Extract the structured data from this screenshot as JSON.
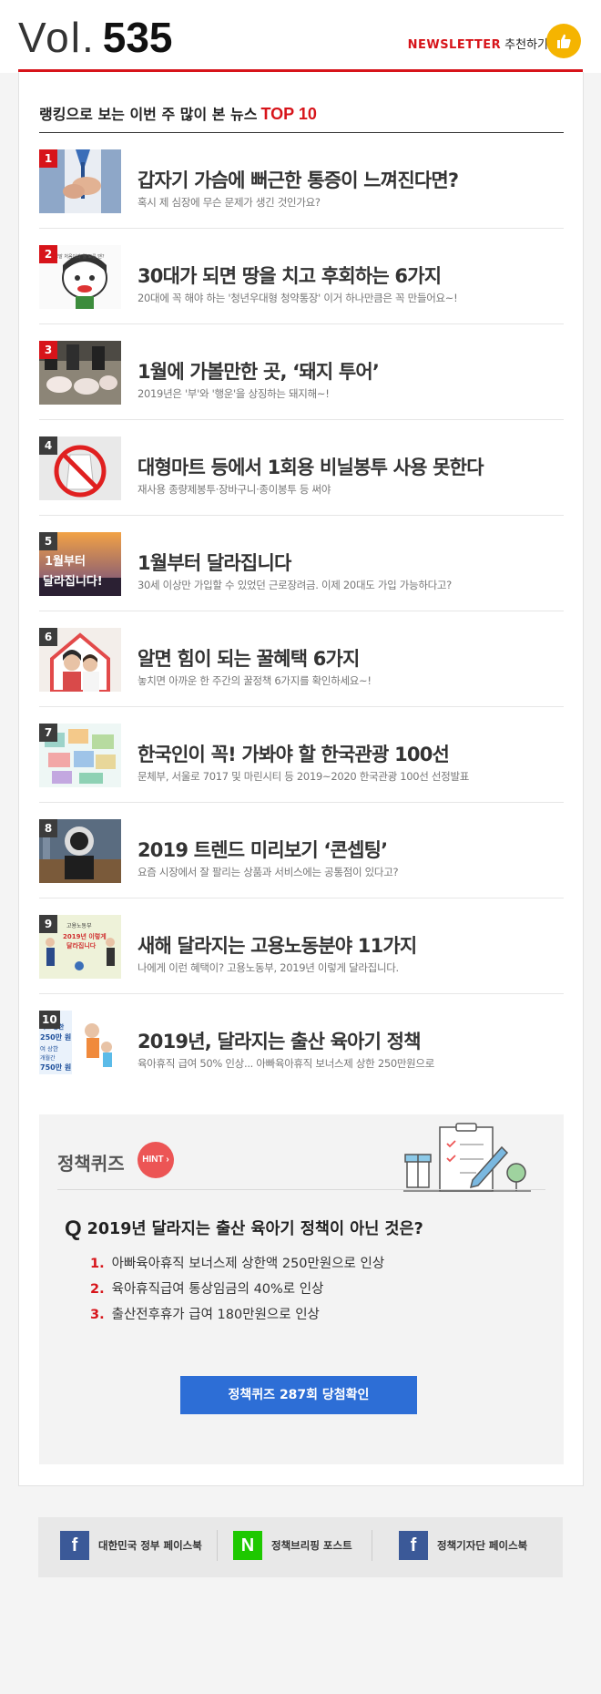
{
  "header": {
    "vol_label": "Vol.",
    "vol_number": "535",
    "newsletter_label": "NEWSLETTER",
    "recommend_label": "추천하기",
    "thumbs_icon": "thumbs-up-icon",
    "accent_color": "#d7141a"
  },
  "ranking": {
    "title_prefix": "랭킹으로 보는 이번 주 많이 본 뉴스",
    "title_top": "TOP 10",
    "items": [
      {
        "rank": "1",
        "title": "갑자기 가슴에 뻐근한 통증이 느껴진다면?",
        "subtitle": "혹시 제 심장에 무슨 문제가 생긴 것인가요?"
      },
      {
        "rank": "2",
        "title": "30대가 되면 땅을 치고 후회하는 6가지",
        "subtitle": "20대에 꼭 해야 하는 '청년우대형 청약통장' 이거 하나만큼은 꼭 만들어요~!"
      },
      {
        "rank": "3",
        "title": "1월에 가볼만한 곳, ‘돼지 투어’",
        "subtitle": "2019년은 '부'와 '행운'을 상징하는 돼지해~!"
      },
      {
        "rank": "4",
        "title": "대형마트 등에서 1회용 비닐봉투 사용 못한다",
        "subtitle": "재사용 종량제봉투·장바구니·종이봉투 등 써야"
      },
      {
        "rank": "5",
        "title": "1월부터 달라집니다",
        "subtitle": "30세 이상만 가입할 수 있었던 근로장려금. 이제 20대도 가입 가능하다고?"
      },
      {
        "rank": "6",
        "title": "알면 힘이 되는 꿀혜택 6가지",
        "subtitle": "놓치면 아까운 한 주간의 꿀정책 6가지를 확인하세요~!"
      },
      {
        "rank": "7",
        "title": "한국인이 꼭! 가봐야 할 한국관광 100선",
        "subtitle": "문체부, 서울로 7017 및 마린시티 등 2019~2020 한국관광 100선 선정발표"
      },
      {
        "rank": "8",
        "title": "2019 트렌드 미리보기 ‘콘셉팅’",
        "subtitle": "요즘 시장에서 잘 팔리는 상품과 서비스에는 공통점이 있다고?"
      },
      {
        "rank": "9",
        "title": "새해 달라지는 고용노동분야 11가지",
        "subtitle": "나에게 이런 혜택이? 고용노동부, 2019년 이렇게 달라집니다."
      },
      {
        "rank": "10",
        "title": "2019년, 달라지는 출산 육아기 정책",
        "subtitle": "육아휴직 급여 50% 인상... 아빠육아휴직 보너스제 상한 250만원으로"
      }
    ],
    "thumb_texts": {
      "t2_small": "30대 정말 처음이라 뭘 모를 땐?",
      "t5_text1": "1월부터",
      "t5_text2": "달라집니다!",
      "t9_top": "고용노동부",
      "t9_main1": "2019년 이렇게",
      "t9_main2": "달라집니다",
      "t10_l1": "너스 상한",
      "t10_l2": "250만 원",
      "t10_l3": "여 상한",
      "t10_l4": "개월간",
      "t10_l5": "750만 원"
    }
  },
  "quiz": {
    "title": "정책퀴즈",
    "hint_label": "HINT",
    "q_mark": "Q",
    "question": "2019년 달라지는 출산 육아기 정책이 아닌 것은?",
    "options": [
      {
        "num": "1.",
        "text": "아빠육아휴직 보너스제 상한액 250만원으로 인상"
      },
      {
        "num": "2.",
        "text": "육아휴직급여 통상임금의 40%로 인상"
      },
      {
        "num": "3.",
        "text": "출산전후휴가 급여 180만원으로 인상"
      }
    ],
    "button_label": "정책퀴즈 287회 당첨확인"
  },
  "footer": {
    "links": [
      {
        "icon": "f",
        "label": "대한민국 정부 페이스북"
      },
      {
        "icon": "N",
        "label": "정책브리핑 포스트"
      },
      {
        "icon": "f",
        "label": "정책기자단 페이스북"
      }
    ]
  }
}
